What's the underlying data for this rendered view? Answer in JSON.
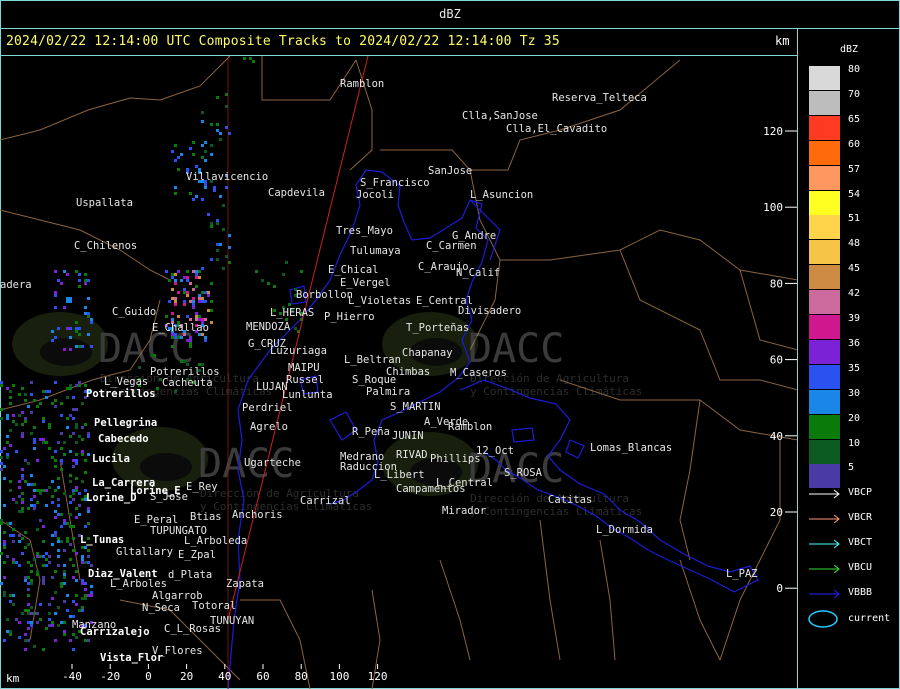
{
  "window": {
    "title": "dBZ"
  },
  "header": {
    "text": "2024/02/22 12:14:00 UTC Composite Tracks to 2024/02/22 12:14:00 Tz 35",
    "units_label": "km"
  },
  "legend": {
    "title": "dBZ",
    "levels": [
      {
        "label": "80",
        "color": "#d9d9d9"
      },
      {
        "label": "70",
        "color": "#bdbdbd"
      },
      {
        "label": "65",
        "color": "#ff3a22"
      },
      {
        "label": "60",
        "color": "#ff6a0a"
      },
      {
        "label": "57",
        "color": "#ff9760"
      },
      {
        "label": "54",
        "color": "#ffff22"
      },
      {
        "label": "51",
        "color": "#ffd34a"
      },
      {
        "label": "48",
        "color": "#f6c548"
      },
      {
        "label": "45",
        "color": "#cc8a42"
      },
      {
        "label": "42",
        "color": "#cc6a9e"
      },
      {
        "label": "39",
        "color": "#d0188e"
      },
      {
        "label": "36",
        "color": "#7c22d6"
      },
      {
        "label": "35",
        "color": "#2a52f0"
      },
      {
        "label": "30",
        "color": "#1a86e8"
      },
      {
        "label": "20",
        "color": "#0a7a0a"
      },
      {
        "label": "10",
        "color": "#0b5a22"
      },
      {
        "label": "5",
        "color": "#4a3aa6"
      }
    ],
    "tracks": [
      {
        "label": "VBCP",
        "color": "#ffffff"
      },
      {
        "label": "VBCR",
        "color": "#ff9977"
      },
      {
        "label": "VBCT",
        "color": "#44ffff"
      },
      {
        "label": "VBCU",
        "color": "#33dd33"
      },
      {
        "label": "VBBB",
        "color": "#2222ff"
      }
    ],
    "current_label": "current",
    "current_color": "#22ccff"
  },
  "axes": {
    "x_unit": "km",
    "x_ticks": [
      "-40",
      "-20",
      "0",
      "20",
      "40",
      "60",
      "80",
      "100",
      "120"
    ],
    "y_ticks": [
      "120",
      "100",
      "80",
      "60",
      "40",
      "20",
      "0"
    ]
  },
  "map": {
    "colors": {
      "place": "#e6e6e6",
      "district": "#ffffff",
      "border": "#8a6440",
      "basin": "#1c1cd8",
      "track": "#cc2222",
      "axis": "#cc2222"
    },
    "places": [
      "Ramblon",
      "Reserva_Telteca",
      "Clla,SanJose",
      "Clla,El_Cavadito",
      "Villavicencio",
      "Capdevila",
      "S_Francisco",
      "Jocoli",
      "SanJose",
      "L_Asuncion",
      "Uspallata",
      "Tres_Mayo",
      "G_Andre",
      "C_Carmen",
      "C_Chilenos",
      "Tulumaya",
      "E_Chical",
      "C_Araujo",
      "E_Vergel",
      "N_Calif",
      "Borbollon",
      "L_Violetas",
      "E_Central",
      "adera",
      "C_Guido",
      "L_HERAS",
      "P_Hierro",
      "Divisadero",
      "E_Challao",
      "MENDOZA",
      "T_Porteñas",
      "G_CRUZ",
      "Luzuriaga",
      "L_Beltran",
      "Chapanay",
      "MAIPU",
      "Chimbas",
      "M_Caseros",
      "Potrerillos",
      "Cacheuta",
      "Russel",
      "S_Roque",
      "L_Vegas",
      "LUJAN",
      "Lunlunta",
      "Palmira",
      "Perdriel",
      "S_MARTIN",
      "A_Verde",
      "Agrelo",
      "R_Peña",
      "JUNIN",
      "Ramblon",
      "Lomas_Blancas",
      "RIVAD",
      "12_Oct",
      "Medrano",
      "Phillips",
      "Ugarteche",
      "Raduccion",
      "L_Libert",
      "S_ROSA",
      "E_Rey",
      "Campamentos",
      "L_Central",
      "Carrizal",
      "Catitas",
      "S_Jose",
      "Mirador",
      "Anchoris",
      "E_Peral",
      "Btias",
      "L_Dormida",
      "TUPUNGATO",
      "L_Arboleda",
      "Gltallary",
      "E_Zpal",
      "L_PAZ",
      "d_Plata",
      "L_Arboles",
      "Zapata",
      "Algarrob",
      "N_Seca",
      "Totoral",
      "TUNUYAN",
      "Manzano",
      "C_L_Rosas",
      "V_Flores"
    ],
    "districts": [
      "Potrerillos",
      "Pellegrina",
      "Cabecedo",
      "Lucila",
      "La_Carrera",
      "Lorine_D",
      "Lorine_E",
      "L_Tunas",
      "Diaz_Valent",
      "Carrizalejo",
      "Vista_Flor"
    ],
    "watermark_text": "DACC",
    "watermark_sub": "Dirección de Agricultura\ny Contingencias Climáticas"
  }
}
